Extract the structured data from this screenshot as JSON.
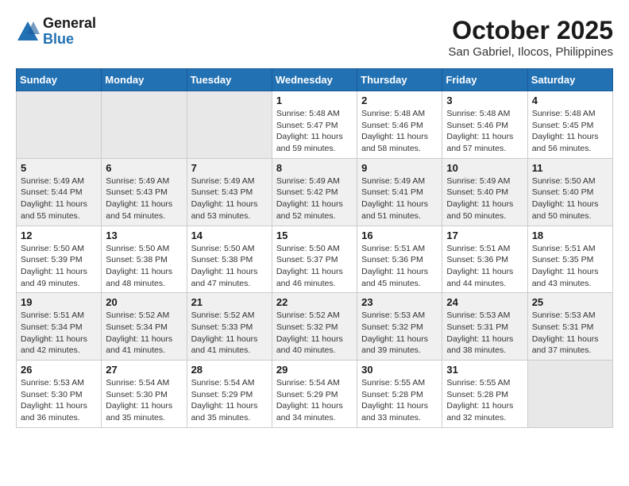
{
  "logo": {
    "general": "General",
    "blue": "Blue"
  },
  "title": "October 2025",
  "location": "San Gabriel, Ilocos, Philippines",
  "weekdays": [
    "Sunday",
    "Monday",
    "Tuesday",
    "Wednesday",
    "Thursday",
    "Friday",
    "Saturday"
  ],
  "weeks": [
    [
      {
        "day": "",
        "info": ""
      },
      {
        "day": "",
        "info": ""
      },
      {
        "day": "",
        "info": ""
      },
      {
        "day": "1",
        "info": "Sunrise: 5:48 AM\nSunset: 5:47 PM\nDaylight: 11 hours\nand 59 minutes."
      },
      {
        "day": "2",
        "info": "Sunrise: 5:48 AM\nSunset: 5:46 PM\nDaylight: 11 hours\nand 58 minutes."
      },
      {
        "day": "3",
        "info": "Sunrise: 5:48 AM\nSunset: 5:46 PM\nDaylight: 11 hours\nand 57 minutes."
      },
      {
        "day": "4",
        "info": "Sunrise: 5:48 AM\nSunset: 5:45 PM\nDaylight: 11 hours\nand 56 minutes."
      }
    ],
    [
      {
        "day": "5",
        "info": "Sunrise: 5:49 AM\nSunset: 5:44 PM\nDaylight: 11 hours\nand 55 minutes."
      },
      {
        "day": "6",
        "info": "Sunrise: 5:49 AM\nSunset: 5:43 PM\nDaylight: 11 hours\nand 54 minutes."
      },
      {
        "day": "7",
        "info": "Sunrise: 5:49 AM\nSunset: 5:43 PM\nDaylight: 11 hours\nand 53 minutes."
      },
      {
        "day": "8",
        "info": "Sunrise: 5:49 AM\nSunset: 5:42 PM\nDaylight: 11 hours\nand 52 minutes."
      },
      {
        "day": "9",
        "info": "Sunrise: 5:49 AM\nSunset: 5:41 PM\nDaylight: 11 hours\nand 51 minutes."
      },
      {
        "day": "10",
        "info": "Sunrise: 5:49 AM\nSunset: 5:40 PM\nDaylight: 11 hours\nand 50 minutes."
      },
      {
        "day": "11",
        "info": "Sunrise: 5:50 AM\nSunset: 5:40 PM\nDaylight: 11 hours\nand 50 minutes."
      }
    ],
    [
      {
        "day": "12",
        "info": "Sunrise: 5:50 AM\nSunset: 5:39 PM\nDaylight: 11 hours\nand 49 minutes."
      },
      {
        "day": "13",
        "info": "Sunrise: 5:50 AM\nSunset: 5:38 PM\nDaylight: 11 hours\nand 48 minutes."
      },
      {
        "day": "14",
        "info": "Sunrise: 5:50 AM\nSunset: 5:38 PM\nDaylight: 11 hours\nand 47 minutes."
      },
      {
        "day": "15",
        "info": "Sunrise: 5:50 AM\nSunset: 5:37 PM\nDaylight: 11 hours\nand 46 minutes."
      },
      {
        "day": "16",
        "info": "Sunrise: 5:51 AM\nSunset: 5:36 PM\nDaylight: 11 hours\nand 45 minutes."
      },
      {
        "day": "17",
        "info": "Sunrise: 5:51 AM\nSunset: 5:36 PM\nDaylight: 11 hours\nand 44 minutes."
      },
      {
        "day": "18",
        "info": "Sunrise: 5:51 AM\nSunset: 5:35 PM\nDaylight: 11 hours\nand 43 minutes."
      }
    ],
    [
      {
        "day": "19",
        "info": "Sunrise: 5:51 AM\nSunset: 5:34 PM\nDaylight: 11 hours\nand 42 minutes."
      },
      {
        "day": "20",
        "info": "Sunrise: 5:52 AM\nSunset: 5:34 PM\nDaylight: 11 hours\nand 41 minutes."
      },
      {
        "day": "21",
        "info": "Sunrise: 5:52 AM\nSunset: 5:33 PM\nDaylight: 11 hours\nand 41 minutes."
      },
      {
        "day": "22",
        "info": "Sunrise: 5:52 AM\nSunset: 5:32 PM\nDaylight: 11 hours\nand 40 minutes."
      },
      {
        "day": "23",
        "info": "Sunrise: 5:53 AM\nSunset: 5:32 PM\nDaylight: 11 hours\nand 39 minutes."
      },
      {
        "day": "24",
        "info": "Sunrise: 5:53 AM\nSunset: 5:31 PM\nDaylight: 11 hours\nand 38 minutes."
      },
      {
        "day": "25",
        "info": "Sunrise: 5:53 AM\nSunset: 5:31 PM\nDaylight: 11 hours\nand 37 minutes."
      }
    ],
    [
      {
        "day": "26",
        "info": "Sunrise: 5:53 AM\nSunset: 5:30 PM\nDaylight: 11 hours\nand 36 minutes."
      },
      {
        "day": "27",
        "info": "Sunrise: 5:54 AM\nSunset: 5:30 PM\nDaylight: 11 hours\nand 35 minutes."
      },
      {
        "day": "28",
        "info": "Sunrise: 5:54 AM\nSunset: 5:29 PM\nDaylight: 11 hours\nand 35 minutes."
      },
      {
        "day": "29",
        "info": "Sunrise: 5:54 AM\nSunset: 5:29 PM\nDaylight: 11 hours\nand 34 minutes."
      },
      {
        "day": "30",
        "info": "Sunrise: 5:55 AM\nSunset: 5:28 PM\nDaylight: 11 hours\nand 33 minutes."
      },
      {
        "day": "31",
        "info": "Sunrise: 5:55 AM\nSunset: 5:28 PM\nDaylight: 11 hours\nand 32 minutes."
      },
      {
        "day": "",
        "info": ""
      }
    ]
  ]
}
